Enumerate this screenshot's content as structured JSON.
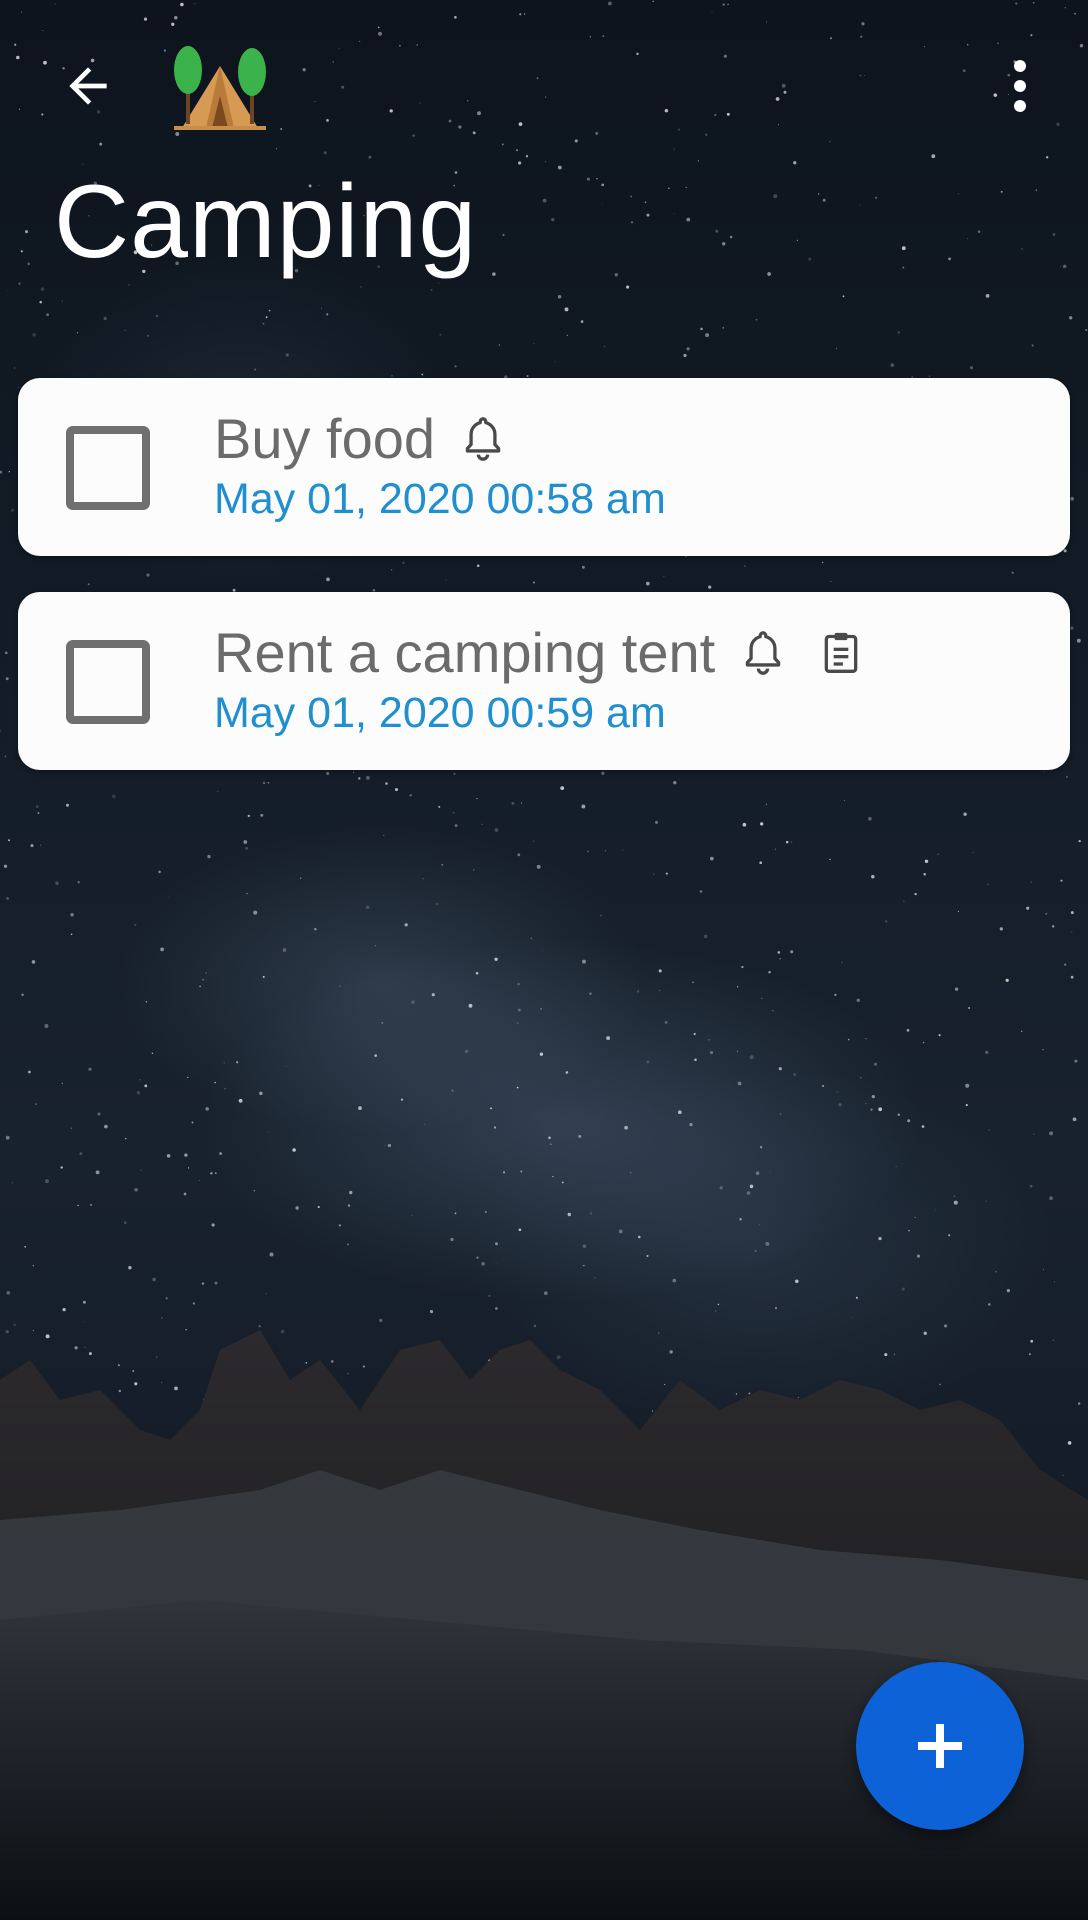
{
  "app_bar": {
    "back_icon": "arrow-left-icon",
    "app_icon": "camping-tent-trees-icon",
    "more_icon": "more-vertical-icon"
  },
  "page": {
    "title": "Camping"
  },
  "tasks": [
    {
      "title": "Buy food",
      "date": "May 01, 2020 00:58 am",
      "checked": false,
      "icons": [
        "bell-icon"
      ]
    },
    {
      "title": "Rent a camping tent",
      "date": "May 01, 2020 00:59 am",
      "checked": false,
      "icons": [
        "bell-icon",
        "clipboard-note-icon"
      ]
    }
  ],
  "fab": {
    "icon": "plus-icon"
  },
  "colors": {
    "accent": "#0d62d7",
    "date_text": "#1f8fcf",
    "task_text": "#6b6b6b",
    "card_background": "#fcfcfc"
  }
}
